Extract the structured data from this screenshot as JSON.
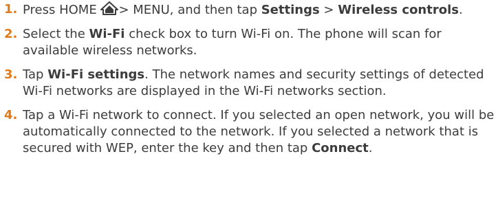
{
  "steps": [
    {
      "number": "1.",
      "text_a": "Press HOME ",
      "home_icon": "home-icon",
      "text_b": "> MENU, and then tap ",
      "bold_a": "Settings",
      "text_c": " > ",
      "bold_b": "Wireless controls",
      "text_d": "."
    },
    {
      "number": "2.",
      "text_a": "Select the ",
      "bold_a": "Wi-Fi",
      "text_b": " check box to turn Wi-Fi on. The phone will scan for available wireless networks."
    },
    {
      "number": "3.",
      "text_a": "Tap ",
      "bold_a": "Wi-Fi settings",
      "text_b": ". The network names and security settings of detected Wi-Fi networks are displayed in the Wi-Fi networks section."
    },
    {
      "number": "4.",
      "text_a": "Tap a Wi-Fi network to connect. If you selected an open network, you will be automatically connected to the network. If you selected a network that is secured with WEP, enter the key and then tap ",
      "bold_a": "Connect",
      "text_b": "."
    }
  ],
  "colors": {
    "step_number": "#e07a1a",
    "body_text": "#3c3c3c"
  }
}
